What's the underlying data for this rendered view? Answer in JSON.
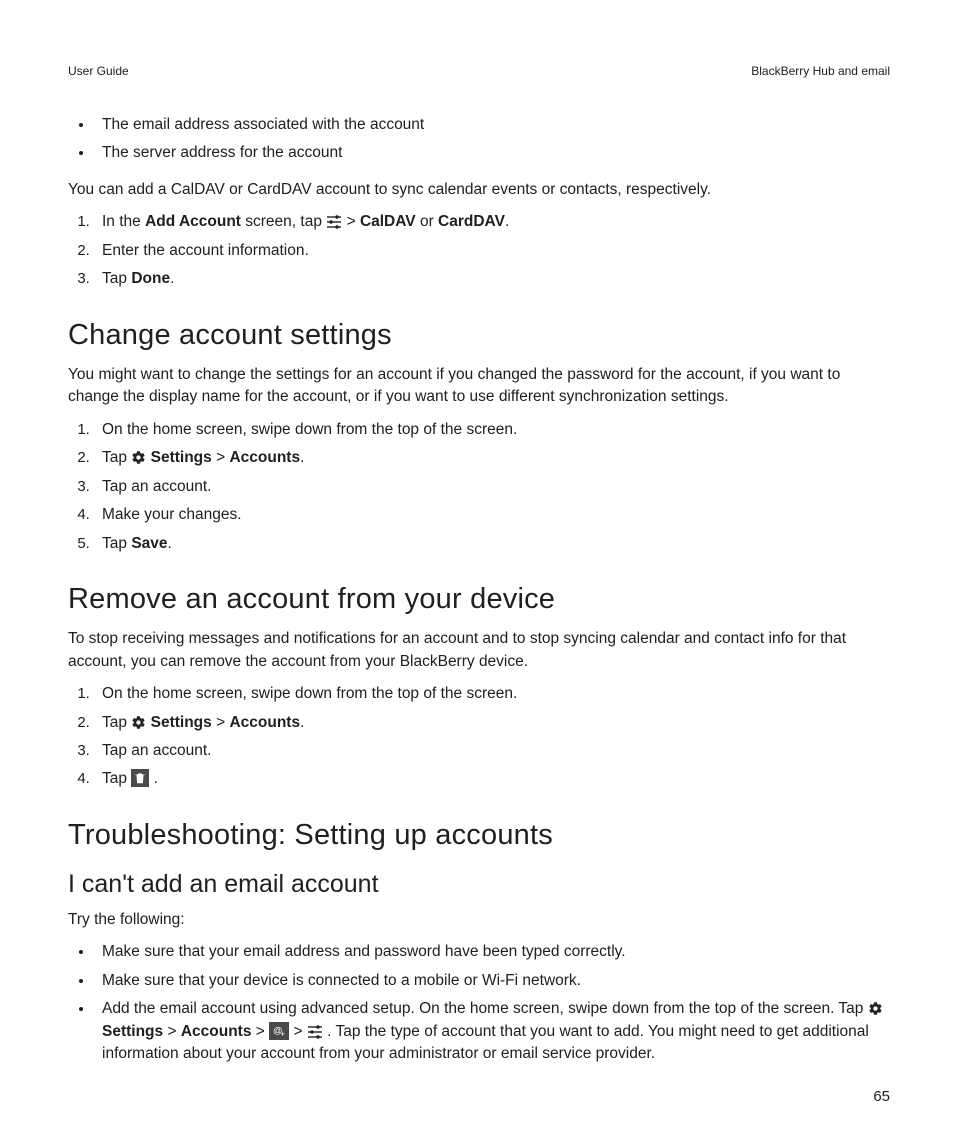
{
  "header": {
    "left": "User Guide",
    "right": "BlackBerry Hub and email"
  },
  "intro_bullets": [
    "The email address associated with the account",
    "The server address for the account"
  ],
  "intro_para": "You can add a CalDAV or CardDAV account to sync calendar events or contacts, respectively.",
  "step1": {
    "prefix": "In the ",
    "bold1": "Add Account",
    "mid1": " screen, tap ",
    "gt": " > ",
    "bold2": "CalDAV",
    "or": " or ",
    "bold3": "CardDAV",
    "suffix": "."
  },
  "step2": "Enter the account information.",
  "step3": {
    "prefix": "Tap ",
    "bold": "Done",
    "suffix": "."
  },
  "sec1": {
    "title": "Change account settings",
    "para": "You might want to change the settings for an account if you changed the password for the account, if you want to change the display name for the account, or if you want to use different synchronization settings.",
    "s1": "On the home screen, swipe down from the top of the screen.",
    "s2": {
      "tap": "Tap ",
      "settings": "Settings",
      "gt": " > ",
      "accounts": "Accounts",
      "dot": "."
    },
    "s3": "Tap an account.",
    "s4": "Make your changes.",
    "s5": {
      "prefix": "Tap ",
      "bold": "Save",
      "suffix": "."
    }
  },
  "sec2": {
    "title": "Remove an account from your device",
    "para": "To stop receiving messages and notifications for an account and to stop syncing calendar and contact info for that account, you can remove the account from your BlackBerry device.",
    "s1": "On the home screen, swipe down from the top of the screen.",
    "s2": {
      "tap": "Tap ",
      "settings": "Settings",
      "gt": " > ",
      "accounts": "Accounts",
      "dot": "."
    },
    "s3": "Tap an account.",
    "s4": {
      "prefix": "Tap ",
      "suffix": "."
    }
  },
  "sec3": {
    "title": "Troubleshooting: Setting up accounts"
  },
  "sec4": {
    "title": "I can't add an email account",
    "para": "Try the following:",
    "b1": "Make sure that your email address and password have been typed correctly.",
    "b2": "Make sure that your device is connected to a mobile or Wi-Fi network.",
    "b3a": "Add the email account using advanced setup. On the home screen, swipe down from the top of the screen. Tap ",
    "b3_settings": "Settings",
    "b3_gt": " > ",
    "b3_accounts": "Accounts",
    "b3b": ". Tap the type of account that you want to add. You might need to get additional information about your account from your administrator or email service provider."
  },
  "pagenum": "65"
}
